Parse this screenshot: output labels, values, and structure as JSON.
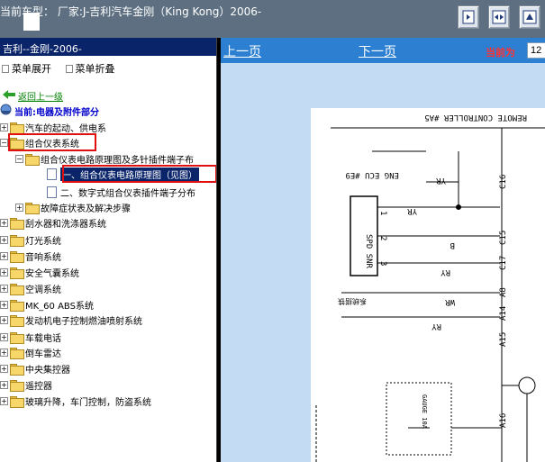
{
  "topbar": {
    "title": "当前车型：  厂家:J-吉利汽车金刚（King Kong）2006-",
    "buttons": [
      "fit-page-icon",
      "fit-width-icon",
      "zoom-icon"
    ]
  },
  "sidebar": {
    "header": "吉利--金刚-2006-",
    "expand_all": "菜单展开",
    "collapse_all": "菜单折叠",
    "back_label": "返回上一级",
    "current_label": "当前:电器及附件部分",
    "items": [
      {
        "label": "汽车的起动、供电系"
      },
      {
        "label": "组合仪表系统"
      },
      {
        "label": "组合仪表电路原理图及多针插件端子布"
      },
      {
        "label": "一、组合仪表电路原理图（见图）"
      },
      {
        "label": "二、数字式组合仪表插件端子分布"
      },
      {
        "label": "故障症状表及解决步骤"
      },
      {
        "label": "刮水器和洗涤器系统"
      },
      {
        "label": "灯光系统"
      },
      {
        "label": "音响系统"
      },
      {
        "label": "安全气囊系统"
      },
      {
        "label": "空调系统"
      },
      {
        "label": "MK_60 ABS系统"
      },
      {
        "label": "发动机电子控制燃油喷射系统"
      },
      {
        "label": "车载电话"
      },
      {
        "label": "倒车雷达"
      },
      {
        "label": "中央集控器"
      },
      {
        "label": "遥控器"
      },
      {
        "label": "玻璃升降，车门控制，防盗系统"
      }
    ]
  },
  "content": {
    "prev_label": "上一页",
    "next_label": "下一页",
    "current_page_label": "当前为",
    "current_page_value": "12"
  },
  "diagram": {
    "labels": {
      "remote": "REMOTE CONTROLLER #A5",
      "eng": "ENG ECU #E9",
      "spd": "SPD SNR",
      "wire_yr1": "YR",
      "wire_yr2": "YR",
      "wire_b": "B",
      "wire_ry": "RY",
      "wire_wr": "WR",
      "wire_ry2": "RY",
      "pin1": "1",
      "pin2": "2",
      "pin3": "3",
      "fuse": "GAUGE 10A",
      "c16": "C16",
      "c15": "C15",
      "c17": "C17",
      "a8": "A8",
      "a14": "A14",
      "a15": "A15",
      "a16": "A16",
      "aux": "系统搭铁"
    }
  }
}
